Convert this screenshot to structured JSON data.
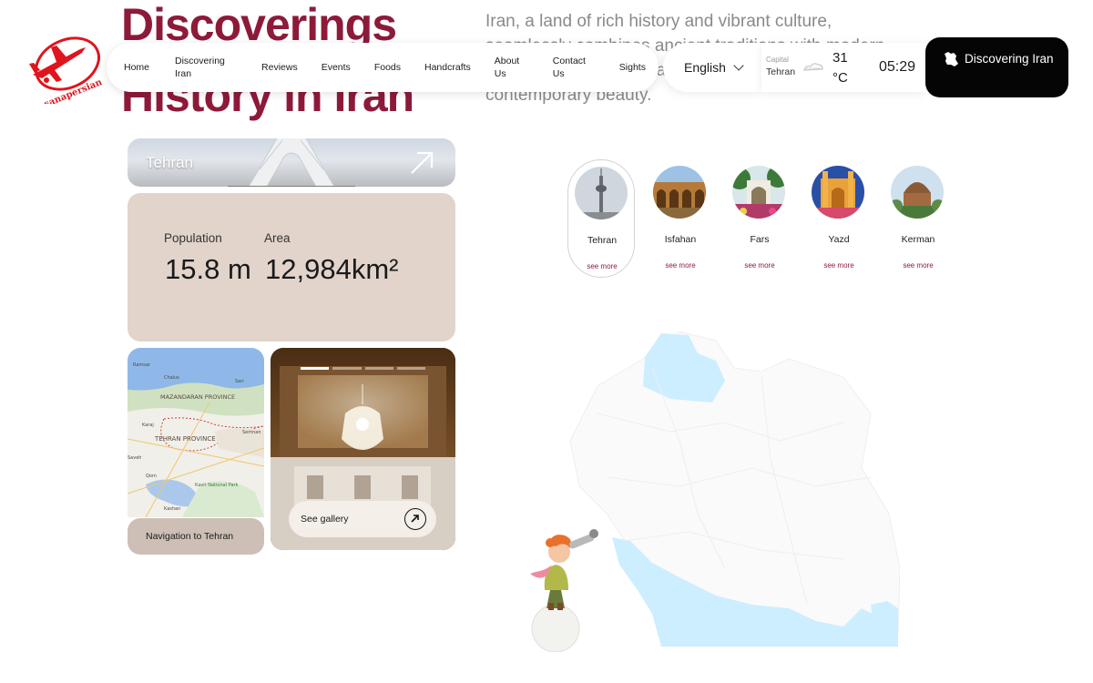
{
  "hero": {
    "title_line1": "Discoverings",
    "title_line2": "History in Iran",
    "description": "Iran, a land of rich history and vibrant culture, seamlessly combines ancient traditions with modern living, offering a captivating mix of heritage and contemporary beauty."
  },
  "brand": {
    "logo_text": "sanapersian",
    "accent": "#8e1a3a",
    "logo_red": "#e0141c"
  },
  "nav": {
    "items": [
      "Home",
      "Discovering Iran",
      "Reviews",
      "Events",
      "Foods",
      "Handcrafts",
      "About Us",
      "Contact Us",
      "Sights"
    ]
  },
  "language": {
    "selected": "English"
  },
  "weather": {
    "capital_label": "Capital",
    "city": "Tehran",
    "temp_value": "31",
    "temp_unit": "°C",
    "time": "05:29"
  },
  "cta": {
    "label": "Discovering Iran"
  },
  "city_card": {
    "name": "Tehran",
    "population_label": "Population",
    "population_value": "15.8 m",
    "area_label": "Area",
    "area_value": "12,984km²"
  },
  "map_card": {
    "nav_label": "Navigation to Tehran",
    "map_labels": [
      "Ramsar",
      "Chalus",
      "Sari",
      "MAZANDARAN PROVINCE",
      "Karaj",
      "TEHRAN PROVINCE",
      "Semnan",
      "Saveh",
      "Qom",
      "Kavir National Park",
      "Kashan"
    ]
  },
  "gallery": {
    "label": "See gallery",
    "slide_index": 1,
    "slide_count": 4
  },
  "cities": [
    {
      "name": "Tehran",
      "more": "see more"
    },
    {
      "name": "Isfahan",
      "more": "see more"
    },
    {
      "name": "Fars",
      "more": "see more"
    },
    {
      "name": "Yazd",
      "more": "see more"
    },
    {
      "name": "Kerman",
      "more": "see more"
    }
  ]
}
